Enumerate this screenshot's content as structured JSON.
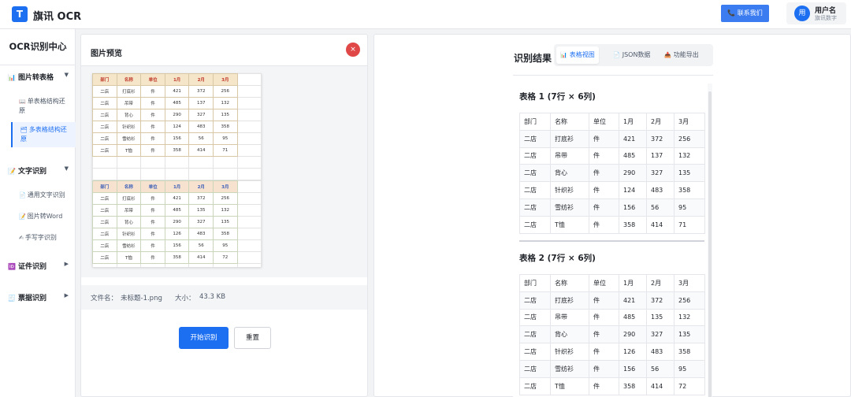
{
  "header": {
    "logo_letter": "T",
    "app_title": "旗讯 OCR",
    "contact_label": "📞 联系我们",
    "user": {
      "avatar": "用",
      "name": "用户名",
      "subtitle": "旗讯数字"
    }
  },
  "sidebar": {
    "title": "OCR识别中心",
    "groups": [
      {
        "icon": "📊",
        "label": "图片转表格",
        "items": [
          {
            "icon": "📖",
            "label": "单表格结构还原",
            "active": false
          },
          {
            "icon": "🗂",
            "label": "多表格结构还原",
            "active": true
          }
        ]
      },
      {
        "icon": "📝",
        "label": "文字识别",
        "items": [
          {
            "icon": "📄",
            "label": "通用文字识别",
            "active": false
          },
          {
            "icon": "📝",
            "label": "图片转Word",
            "active": false
          },
          {
            "icon": "✍",
            "label": "手写字识别",
            "active": false
          }
        ]
      },
      {
        "icon": "🆔",
        "label": "证件识别",
        "items": []
      },
      {
        "icon": "🧾",
        "label": "票据识别",
        "items": []
      }
    ]
  },
  "preview": {
    "title": "图片预览",
    "close_icon": "×",
    "image_tables": [
      {
        "header": [
          "部门",
          "名称",
          "单位",
          "1月",
          "2月",
          "3月"
        ],
        "rows": [
          [
            "二店",
            "打底衫",
            "件",
            "421",
            "372",
            "256"
          ],
          [
            "二店",
            "吊带",
            "件",
            "485",
            "137",
            "132"
          ],
          [
            "二店",
            "背心",
            "件",
            "290",
            "327",
            "135"
          ],
          [
            "二店",
            "针织衫",
            "件",
            "124",
            "483",
            "358"
          ],
          [
            "二店",
            "雪纺衫",
            "件",
            "156",
            "56",
            "95"
          ],
          [
            "二店",
            "T恤",
            "件",
            "358",
            "414",
            "71"
          ]
        ]
      },
      {
        "header": [
          "部门",
          "名称",
          "单位",
          "1月",
          "2月",
          "3月"
        ],
        "rows": [
          [
            "二店",
            "打底衫",
            "件",
            "421",
            "372",
            "256"
          ],
          [
            "二店",
            "吊带",
            "件",
            "485",
            "135",
            "132"
          ],
          [
            "二店",
            "背心",
            "件",
            "290",
            "327",
            "135"
          ],
          [
            "二店",
            "针织衫",
            "件",
            "126",
            "483",
            "358"
          ],
          [
            "二店",
            "雪纺衫",
            "件",
            "156",
            "56",
            "95"
          ],
          [
            "二店",
            "T恤",
            "件",
            "358",
            "414",
            "72"
          ]
        ]
      }
    ],
    "file_name_label": "文件名：",
    "file_name": "未标题-1.png",
    "file_size_label": "大小：",
    "file_size": "43.3 KB",
    "start_label": "开始识别",
    "reset_label": "重置"
  },
  "results": {
    "title": "识别结果",
    "tabs": [
      {
        "icon": "📊",
        "label": "表格视图",
        "active": true
      },
      {
        "icon": "📄",
        "label": "JSON数据",
        "active": false
      },
      {
        "icon": "📥",
        "label": "功能导出",
        "active": false
      }
    ],
    "tables": [
      {
        "title": "表格 1 (7行 × 6列)",
        "header": [
          "部门",
          "名称",
          "单位",
          "1月",
          "2月",
          "3月"
        ],
        "rows": [
          [
            "二店",
            "打底衫",
            "件",
            "421",
            "372",
            "256"
          ],
          [
            "二店",
            "吊带",
            "件",
            "485",
            "137",
            "132"
          ],
          [
            "二店",
            "背心",
            "件",
            "290",
            "327",
            "135"
          ],
          [
            "二店",
            "针织衫",
            "件",
            "124",
            "483",
            "358"
          ],
          [
            "二店",
            "雪纺衫",
            "件",
            "156",
            "56",
            "95"
          ],
          [
            "二店",
            "T恤",
            "件",
            "358",
            "414",
            "71"
          ]
        ]
      },
      {
        "title": "表格 2 (7行 × 6列)",
        "header": [
          "部门",
          "名称",
          "单位",
          "1月",
          "2月",
          "3月"
        ],
        "rows": [
          [
            "二店",
            "打底衫",
            "件",
            "421",
            "372",
            "256"
          ],
          [
            "二店",
            "吊带",
            "件",
            "485",
            "135",
            "132"
          ],
          [
            "二店",
            "背心",
            "件",
            "290",
            "327",
            "135"
          ],
          [
            "二店",
            "针织衫",
            "件",
            "126",
            "483",
            "358"
          ],
          [
            "二店",
            "雪纺衫",
            "件",
            "156",
            "56",
            "95"
          ],
          [
            "二店",
            "T恤",
            "件",
            "358",
            "414",
            "72"
          ]
        ]
      }
    ]
  },
  "colors": {
    "primary": "#1d6ff2",
    "danger": "#e04848",
    "sidebar_active_bg": "#eef4ff"
  }
}
